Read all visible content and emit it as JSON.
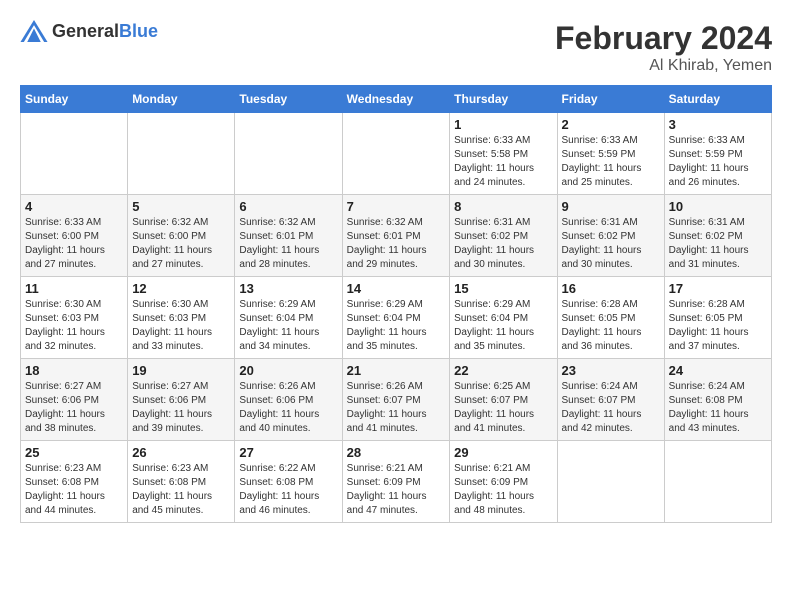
{
  "header": {
    "logo_general": "General",
    "logo_blue": "Blue",
    "month_title": "February 2024",
    "location": "Al Khirab, Yemen"
  },
  "calendar": {
    "days_of_week": [
      "Sunday",
      "Monday",
      "Tuesday",
      "Wednesday",
      "Thursday",
      "Friday",
      "Saturday"
    ],
    "weeks": [
      [
        {
          "day": "",
          "info": ""
        },
        {
          "day": "",
          "info": ""
        },
        {
          "day": "",
          "info": ""
        },
        {
          "day": "",
          "info": ""
        },
        {
          "day": "1",
          "info": "Sunrise: 6:33 AM\nSunset: 5:58 PM\nDaylight: 11 hours and 24 minutes."
        },
        {
          "day": "2",
          "info": "Sunrise: 6:33 AM\nSunset: 5:59 PM\nDaylight: 11 hours and 25 minutes."
        },
        {
          "day": "3",
          "info": "Sunrise: 6:33 AM\nSunset: 5:59 PM\nDaylight: 11 hours and 26 minutes."
        }
      ],
      [
        {
          "day": "4",
          "info": "Sunrise: 6:33 AM\nSunset: 6:00 PM\nDaylight: 11 hours and 27 minutes."
        },
        {
          "day": "5",
          "info": "Sunrise: 6:32 AM\nSunset: 6:00 PM\nDaylight: 11 hours and 27 minutes."
        },
        {
          "day": "6",
          "info": "Sunrise: 6:32 AM\nSunset: 6:01 PM\nDaylight: 11 hours and 28 minutes."
        },
        {
          "day": "7",
          "info": "Sunrise: 6:32 AM\nSunset: 6:01 PM\nDaylight: 11 hours and 29 minutes."
        },
        {
          "day": "8",
          "info": "Sunrise: 6:31 AM\nSunset: 6:02 PM\nDaylight: 11 hours and 30 minutes."
        },
        {
          "day": "9",
          "info": "Sunrise: 6:31 AM\nSunset: 6:02 PM\nDaylight: 11 hours and 30 minutes."
        },
        {
          "day": "10",
          "info": "Sunrise: 6:31 AM\nSunset: 6:02 PM\nDaylight: 11 hours and 31 minutes."
        }
      ],
      [
        {
          "day": "11",
          "info": "Sunrise: 6:30 AM\nSunset: 6:03 PM\nDaylight: 11 hours and 32 minutes."
        },
        {
          "day": "12",
          "info": "Sunrise: 6:30 AM\nSunset: 6:03 PM\nDaylight: 11 hours and 33 minutes."
        },
        {
          "day": "13",
          "info": "Sunrise: 6:29 AM\nSunset: 6:04 PM\nDaylight: 11 hours and 34 minutes."
        },
        {
          "day": "14",
          "info": "Sunrise: 6:29 AM\nSunset: 6:04 PM\nDaylight: 11 hours and 35 minutes."
        },
        {
          "day": "15",
          "info": "Sunrise: 6:29 AM\nSunset: 6:04 PM\nDaylight: 11 hours and 35 minutes."
        },
        {
          "day": "16",
          "info": "Sunrise: 6:28 AM\nSunset: 6:05 PM\nDaylight: 11 hours and 36 minutes."
        },
        {
          "day": "17",
          "info": "Sunrise: 6:28 AM\nSunset: 6:05 PM\nDaylight: 11 hours and 37 minutes."
        }
      ],
      [
        {
          "day": "18",
          "info": "Sunrise: 6:27 AM\nSunset: 6:06 PM\nDaylight: 11 hours and 38 minutes."
        },
        {
          "day": "19",
          "info": "Sunrise: 6:27 AM\nSunset: 6:06 PM\nDaylight: 11 hours and 39 minutes."
        },
        {
          "day": "20",
          "info": "Sunrise: 6:26 AM\nSunset: 6:06 PM\nDaylight: 11 hours and 40 minutes."
        },
        {
          "day": "21",
          "info": "Sunrise: 6:26 AM\nSunset: 6:07 PM\nDaylight: 11 hours and 41 minutes."
        },
        {
          "day": "22",
          "info": "Sunrise: 6:25 AM\nSunset: 6:07 PM\nDaylight: 11 hours and 41 minutes."
        },
        {
          "day": "23",
          "info": "Sunrise: 6:24 AM\nSunset: 6:07 PM\nDaylight: 11 hours and 42 minutes."
        },
        {
          "day": "24",
          "info": "Sunrise: 6:24 AM\nSunset: 6:08 PM\nDaylight: 11 hours and 43 minutes."
        }
      ],
      [
        {
          "day": "25",
          "info": "Sunrise: 6:23 AM\nSunset: 6:08 PM\nDaylight: 11 hours and 44 minutes."
        },
        {
          "day": "26",
          "info": "Sunrise: 6:23 AM\nSunset: 6:08 PM\nDaylight: 11 hours and 45 minutes."
        },
        {
          "day": "27",
          "info": "Sunrise: 6:22 AM\nSunset: 6:08 PM\nDaylight: 11 hours and 46 minutes."
        },
        {
          "day": "28",
          "info": "Sunrise: 6:21 AM\nSunset: 6:09 PM\nDaylight: 11 hours and 47 minutes."
        },
        {
          "day": "29",
          "info": "Sunrise: 6:21 AM\nSunset: 6:09 PM\nDaylight: 11 hours and 48 minutes."
        },
        {
          "day": "",
          "info": ""
        },
        {
          "day": "",
          "info": ""
        }
      ]
    ]
  }
}
